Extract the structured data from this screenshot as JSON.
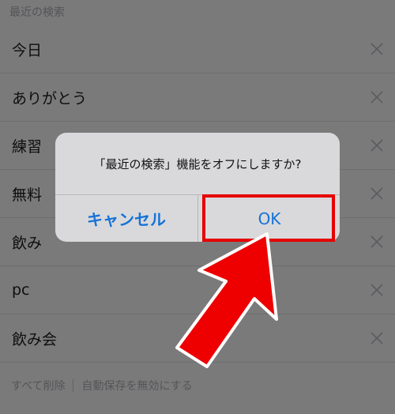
{
  "section_header": "最近の検索",
  "recent_searches": [
    {
      "label": "今日"
    },
    {
      "label": "ありがとう"
    },
    {
      "label": "練習"
    },
    {
      "label": "無料"
    },
    {
      "label": "飲み"
    },
    {
      "label": "pc"
    },
    {
      "label": "飲み会"
    }
  ],
  "footer": {
    "delete_all": "すべて削除",
    "disable_autosave": "自動保存を無効にする"
  },
  "dialog": {
    "message": "「最近の検索」機能をオフにしますか?",
    "cancel_label": "キャンセル",
    "ok_label": "OK"
  },
  "colors": {
    "accent": "#1672d6",
    "highlight": "#e60000",
    "overlay_background": "#7a7a7b",
    "dialog_background": "#d9d9dc"
  },
  "icons": {
    "row_clear": "close-icon",
    "annotation": "red-arrow-annotation"
  }
}
